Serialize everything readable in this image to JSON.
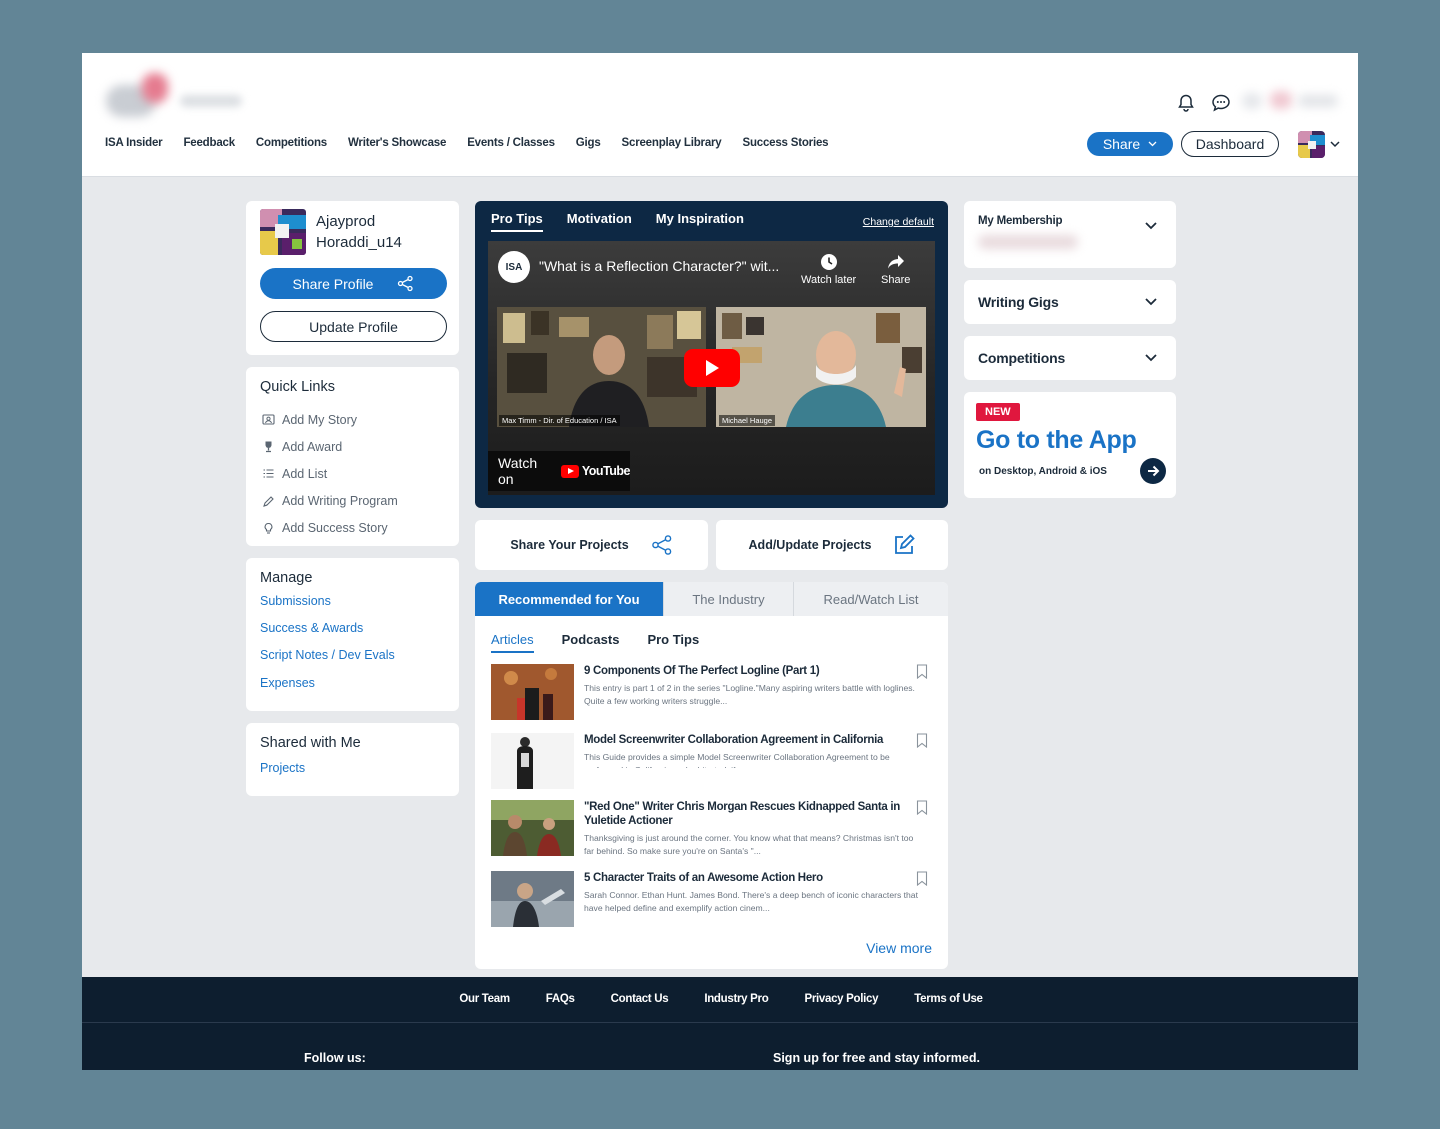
{
  "nav": {
    "items": [
      "ISA Insider",
      "Feedback",
      "Competitions",
      "Writer's Showcase",
      "Events / Classes",
      "Gigs",
      "Screenplay Library",
      "Success Stories"
    ],
    "share_label": "Share",
    "dashboard_label": "Dashboard"
  },
  "profile": {
    "name_line1": "Ajayprod",
    "name_line2": "Horaddi_u14",
    "share_label": "Share Profile",
    "update_label": "Update Profile"
  },
  "quick_links": {
    "title": "Quick Links",
    "items": [
      {
        "label": "Add My Story",
        "icon": "story-icon"
      },
      {
        "label": "Add Award",
        "icon": "trophy-icon"
      },
      {
        "label": "Add List",
        "icon": "list-icon"
      },
      {
        "label": "Add Writing Program",
        "icon": "pen-icon"
      },
      {
        "label": "Add Success Story",
        "icon": "bulb-icon"
      }
    ]
  },
  "manage": {
    "title": "Manage",
    "items": [
      "Submissions",
      "Success & Awards",
      "Script Notes / Dev Evals",
      "Expenses"
    ]
  },
  "shared": {
    "title": "Shared with Me",
    "items": [
      "Projects"
    ]
  },
  "video": {
    "tabs": [
      "Pro Tips",
      "Motivation",
      "My Inspiration"
    ],
    "change_default": "Change default",
    "channel_badge": "ISA",
    "title": "\"What is a Reflection Character?\" wit...",
    "watch_later": "Watch later",
    "share": "Share",
    "caption_left": "Max Timm - Dir. of Education / ISA",
    "caption_right": "Michael Hauge",
    "watch_on": "Watch on",
    "youtube": "YouTube"
  },
  "actions": {
    "share_projects": "Share Your Projects",
    "add_projects": "Add/Update Projects"
  },
  "feed": {
    "tabs": [
      "Recommended for You",
      "The Industry",
      "Read/Watch List"
    ],
    "subtabs": [
      "Articles",
      "Podcasts",
      "Pro Tips"
    ],
    "articles": [
      {
        "title": "9 Components Of The Perfect Logline (Part 1)",
        "desc": "This entry is part 1 of 2 in the series \"Logline.\"Many aspiring writers battle with loglines. Quite a few working writers struggle..."
      },
      {
        "title": "Model Screenwriter Collaboration Agreement in California",
        "desc": "This Guide provides a simple Model Screenwriter Collaboration Agreement to be performed in California and arbitrated, if necessary..."
      },
      {
        "title": "\"Red One\" Writer Chris Morgan Rescues Kidnapped Santa in Yuletide Actioner",
        "desc": "Thanksgiving is just around the corner. You know what that means? Christmas isn't too far behind. So make sure you're on Santa's \"..."
      },
      {
        "title": "5 Character Traits of an Awesome Action Hero",
        "desc": "Sarah Connor. Ethan Hunt. James Bond. There's a deep bench of iconic characters that have helped define and exemplify action cinem..."
      }
    ],
    "view_more": "View more"
  },
  "right": {
    "membership": "My Membership",
    "gigs": "Writing Gigs",
    "competitions": "Competitions",
    "app_badge": "NEW",
    "app_title": "Go to the App",
    "app_sub": "on Desktop, Android & iOS"
  },
  "footer": {
    "links": [
      "Our Team",
      "FAQs",
      "Contact Us",
      "Industry Pro",
      "Privacy Policy",
      "Terms of Use"
    ],
    "follow": "Follow us:",
    "signup": "Sign up for free and stay informed."
  },
  "colors": {
    "accent": "#1a73c6",
    "navy": "#0d2844",
    "new_badge": "#e0173e",
    "page_bg": "#e7e9ec",
    "backdrop": "#628596"
  }
}
